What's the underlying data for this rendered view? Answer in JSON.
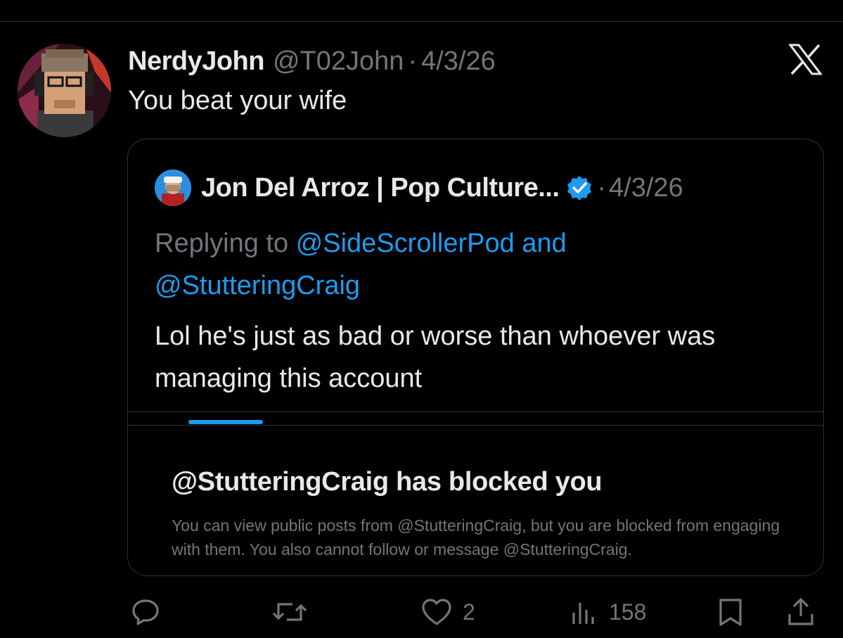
{
  "tweet": {
    "author_name": "NerdyJohn",
    "author_handle": "@T02John",
    "separator": "·",
    "date": "4/3/26",
    "text": "You beat your wife"
  },
  "quoted": {
    "author_name": "Jon Del Arroz | Pop Culture...",
    "separator": "·",
    "date": "4/3/26",
    "replying_prefix": "Replying to",
    "mention_1": "@SideScrollerPod",
    "conjunction": "and",
    "mention_2": "@StutteringCraig",
    "text": "Lol he's just as bad or worse than whoever was managing this account",
    "verified": true
  },
  "blocked": {
    "title": "@StutteringCraig has blocked you",
    "description": "You can view public posts from @StutteringCraig, but you are blocked from engaging with them. You also cannot follow or message @StutteringCraig."
  },
  "actions": {
    "reply_icon": "reply-icon",
    "repost_icon": "repost-icon",
    "like_icon": "heart-icon",
    "like_count": "2",
    "views_icon": "views-icon",
    "view_count": "158",
    "bookmark_icon": "bookmark-icon",
    "share_icon": "share-icon"
  },
  "colors": {
    "background": "#000000",
    "text": "#e7e9ea",
    "muted": "#71767b",
    "link": "#1d9bf0",
    "border": "#2f3336"
  }
}
